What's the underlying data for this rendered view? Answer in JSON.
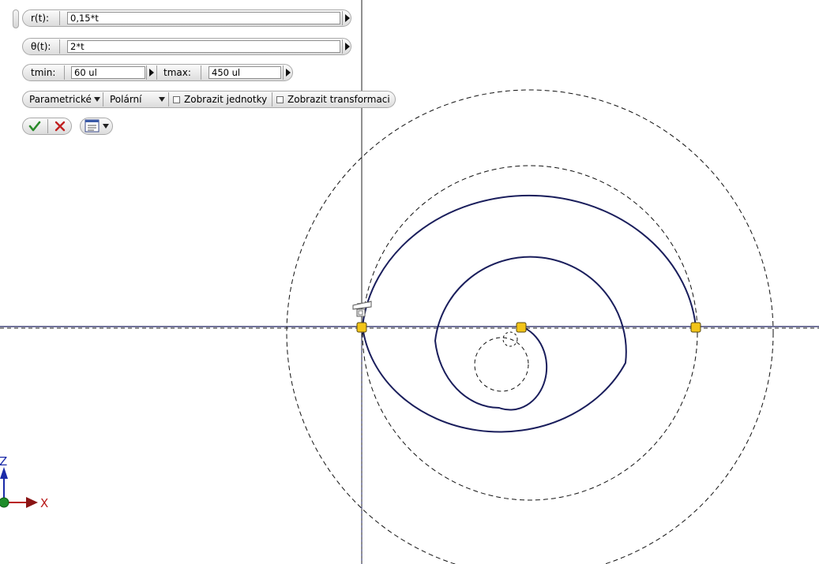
{
  "toolbar": {
    "r_label": "r(t):",
    "r_value": "0,15*t",
    "theta_label": "θ(t):",
    "theta_value": "2*t",
    "tmin_label": "tmin:",
    "tmin_value": "60 ul",
    "tmax_label": "tmax:",
    "tmax_value": "450 ul",
    "type_label": "Parametrické",
    "coord_label": "Polární",
    "show_units_label": "Zobrazit jednotky",
    "show_units_checked": false,
    "show_transform_label": "Zobrazit transformaci",
    "show_transform_checked": false
  },
  "axes": {
    "z_label": "Z",
    "x_label": "X"
  },
  "colors": {
    "curve": "#1a1e5c",
    "construction": "#111111",
    "handle_fill": "#f2c419",
    "confirm": "#2a8a2a",
    "cancel": "#c02020",
    "axis_z": "#1a2aa8",
    "axis_x": "#b81818",
    "origin": "#1e8c2a"
  },
  "icons": [
    "check-icon",
    "cross-icon",
    "options-menu-icon",
    "tool-cursor-icon"
  ]
}
